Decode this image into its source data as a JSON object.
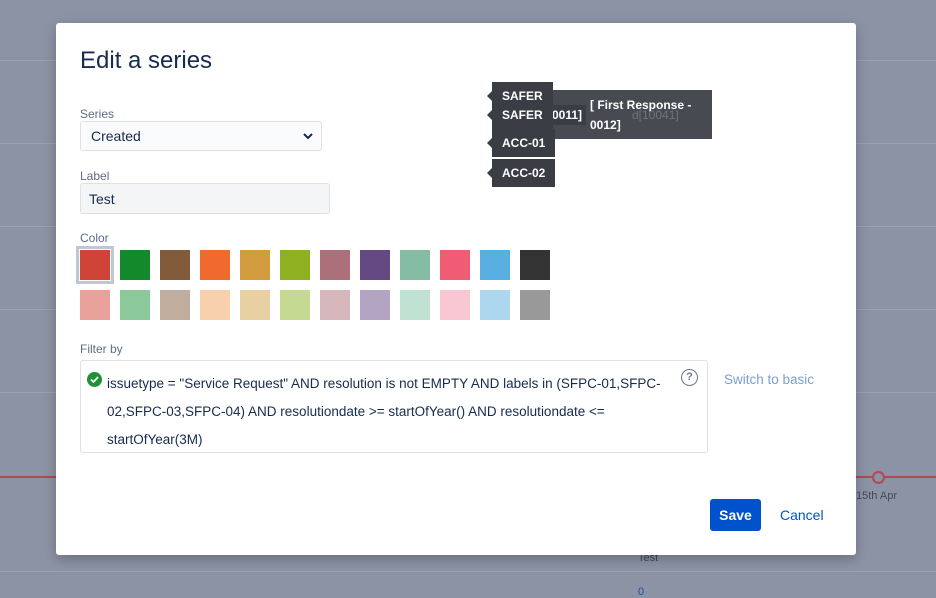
{
  "background": {
    "date_label": "15th Apr",
    "legend_test": "Test",
    "value_zero": "0"
  },
  "modal": {
    "title": "Edit a series",
    "series": {
      "label": "Series",
      "value": "Created"
    },
    "label_field": {
      "label": "Label",
      "value": "Test"
    },
    "color": {
      "label": "Color",
      "selected_index": 0,
      "row1": [
        "#d04437",
        "#14892c",
        "#815b3a",
        "#f06a2e",
        "#d39c3f",
        "#8eb021",
        "#ac707a",
        "#654982",
        "#84bda4",
        "#f15c75",
        "#59afe1",
        "#333333"
      ],
      "row2": [
        "#e8a29b",
        "#8cc99a",
        "#c0ad9d",
        "#f8d0ae",
        "#e9d0a2",
        "#c6d992",
        "#d6b8bc",
        "#b3a4c3",
        "#c0e2d3",
        "#f9c6d3",
        "#acd7ef",
        "#999999"
      ]
    },
    "filter": {
      "label": "Filter by",
      "jql": "issuetype = \"Service Request\" AND resolution is not EMPTY AND labels in (SFPC-01,SFPC-02,SFPC-03,SFPC-04) AND resolutiondate >= startOfYear() AND resolutiondate <= startOfYear(3M)",
      "switch_label": "Switch to basic"
    },
    "save_label": "Save",
    "cancel_label": "Cancel"
  },
  "tooltips": {
    "back_line1": "[ First Response -",
    "back_line2": "0012]",
    "back_ghost": "d[10041]",
    "frag": "0011]",
    "items": [
      "SAFER",
      "SAFER",
      "ACC-01",
      "ACC-02"
    ]
  }
}
